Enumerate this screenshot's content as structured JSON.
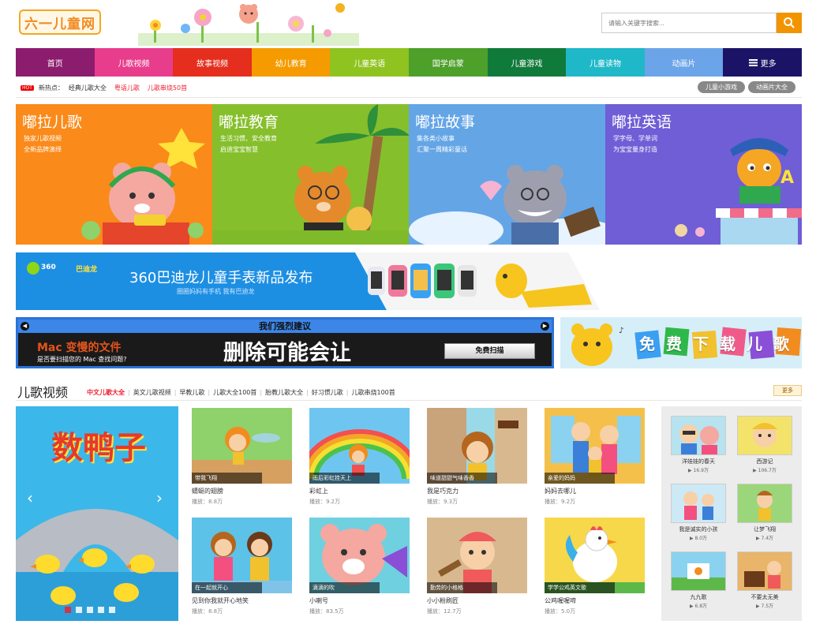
{
  "header": {
    "logo_text": "六一儿童网",
    "search_placeholder": "请输入关键字搜索..."
  },
  "nav": [
    {
      "label": "首页",
      "color": "#8c1c6e"
    },
    {
      "label": "儿歌视频",
      "color": "#e83d8c"
    },
    {
      "label": "故事视频",
      "color": "#e52e1d"
    },
    {
      "label": "幼儿教育",
      "color": "#f59b00"
    },
    {
      "label": "儿童英语",
      "color": "#8fc31f"
    },
    {
      "label": "国学启蒙",
      "color": "#4da02a"
    },
    {
      "label": "儿童游戏",
      "color": "#107a3a"
    },
    {
      "label": "儿童读物",
      "color": "#1fb8c9"
    },
    {
      "label": "动画片",
      "color": "#6ba4e8"
    },
    {
      "label": "更多",
      "color": "#1b1466"
    }
  ],
  "hotbar": {
    "tag": "HOT",
    "label": "新热点：",
    "links": [
      {
        "text": "经典儿歌大全",
        "highlight": false
      },
      {
        "text": "粤语儿歌",
        "highlight": true
      },
      {
        "text": "儿歌串烧50首",
        "highlight": true
      }
    ],
    "pills": [
      "儿童小游戏",
      "动画片大全"
    ]
  },
  "tiles": [
    {
      "title": "嘟拉儿歌",
      "line1": "独家儿歌视频",
      "line2": "全新品牌演绎",
      "color": "#fa8a1a"
    },
    {
      "title": "嘟拉教育",
      "line1": "生活习惯、安全教育",
      "line2": "启迪宝宝智慧",
      "color": "#86bf2c"
    },
    {
      "title": "嘟拉故事",
      "line1": "集各类小故事",
      "line2": "汇聚一周精彩童话",
      "color": "#64a5e6"
    },
    {
      "title": "嘟拉英语",
      "line1": "学字母、学单词",
      "line2": "为宝宝量身打造",
      "color": "#6f5ed6"
    }
  ],
  "banner": {
    "brand1": "360",
    "brand2": "巴迪龙",
    "headline": "360巴迪龙儿童手表新品发布",
    "sub": "圈圈妈妈有手机 我有巴迪龙"
  },
  "ad": {
    "header": "我们强烈建议",
    "title": "Mac 变慢的文件",
    "subtitle": "是否要扫描您的 Mac 查找问题?",
    "big": "删除可能会让",
    "button": "免费扫描"
  },
  "download": {
    "text": "免费下载儿歌"
  },
  "section": {
    "title": "儿歌视频",
    "tabs": [
      {
        "label": "中文儿歌大全",
        "active": true
      },
      {
        "label": "英文儿歌视频",
        "active": false
      },
      {
        "label": "早教儿歌",
        "active": false
      },
      {
        "label": "儿歌大全100首",
        "active": false
      },
      {
        "label": "胎教儿歌大全",
        "active": false
      },
      {
        "label": "好习惯儿歌",
        "active": false
      },
      {
        "label": "儿歌串烧100首",
        "active": false
      }
    ],
    "more": "更多"
  },
  "slider": {
    "title": "数鸭子",
    "dots": 5,
    "active_dot": 0
  },
  "videos": [
    {
      "caption": "带我飞翔",
      "name": "蜻蜓的翅膀",
      "plays": "播放：8.8万",
      "bg": "#8fd16a"
    },
    {
      "caption": "雨后彩虹挂天上",
      "name": "彩虹上",
      "plays": "播放：9.2万",
      "bg": "#6ec6f0"
    },
    {
      "caption": "味道甜甜气味香香",
      "name": "我是巧克力",
      "plays": "播放：9.3万",
      "bg": "#9ad9e8"
    },
    {
      "caption": "亲爱的妈妈",
      "name": "妈妈去哪儿",
      "plays": "播放：9.2万",
      "bg": "#f5c04a"
    },
    {
      "caption": "在一起就开心",
      "name": "见到你我就开心地笑",
      "plays": "播放：8.8万",
      "bg": "#5cc2e8"
    },
    {
      "caption": "滴滴的吹",
      "name": "小喇号",
      "plays": "播放：83.5万",
      "bg": "#6fd0e0"
    },
    {
      "caption": "勤劳的小格格",
      "name": "小小粉刷匠",
      "plays": "播放：12.7万",
      "bg": "#c9a37a"
    },
    {
      "caption": "学学公鸡英文歌",
      "name": "公鸡喔喔啼",
      "plays": "播放：5.0万",
      "bg": "#f7d84a"
    }
  ],
  "side": [
    {
      "name": "洋娃娃的春天",
      "plays": "16.9万",
      "bg": "#b6e3ef"
    },
    {
      "name": "西游记",
      "plays": "106.7万",
      "bg": "#f3e36b"
    },
    {
      "name": "我是诚实的小孩",
      "plays": "8.0万",
      "bg": "#cde9f5"
    },
    {
      "name": "让梦飞翔",
      "plays": "7.4万",
      "bg": "#9bd67a"
    },
    {
      "name": "九九歌",
      "plays": "6.8万",
      "bg": "#8ad2f0"
    },
    {
      "name": "不要太无美",
      "plays": "7.5万",
      "bg": "#e8b56a"
    }
  ]
}
